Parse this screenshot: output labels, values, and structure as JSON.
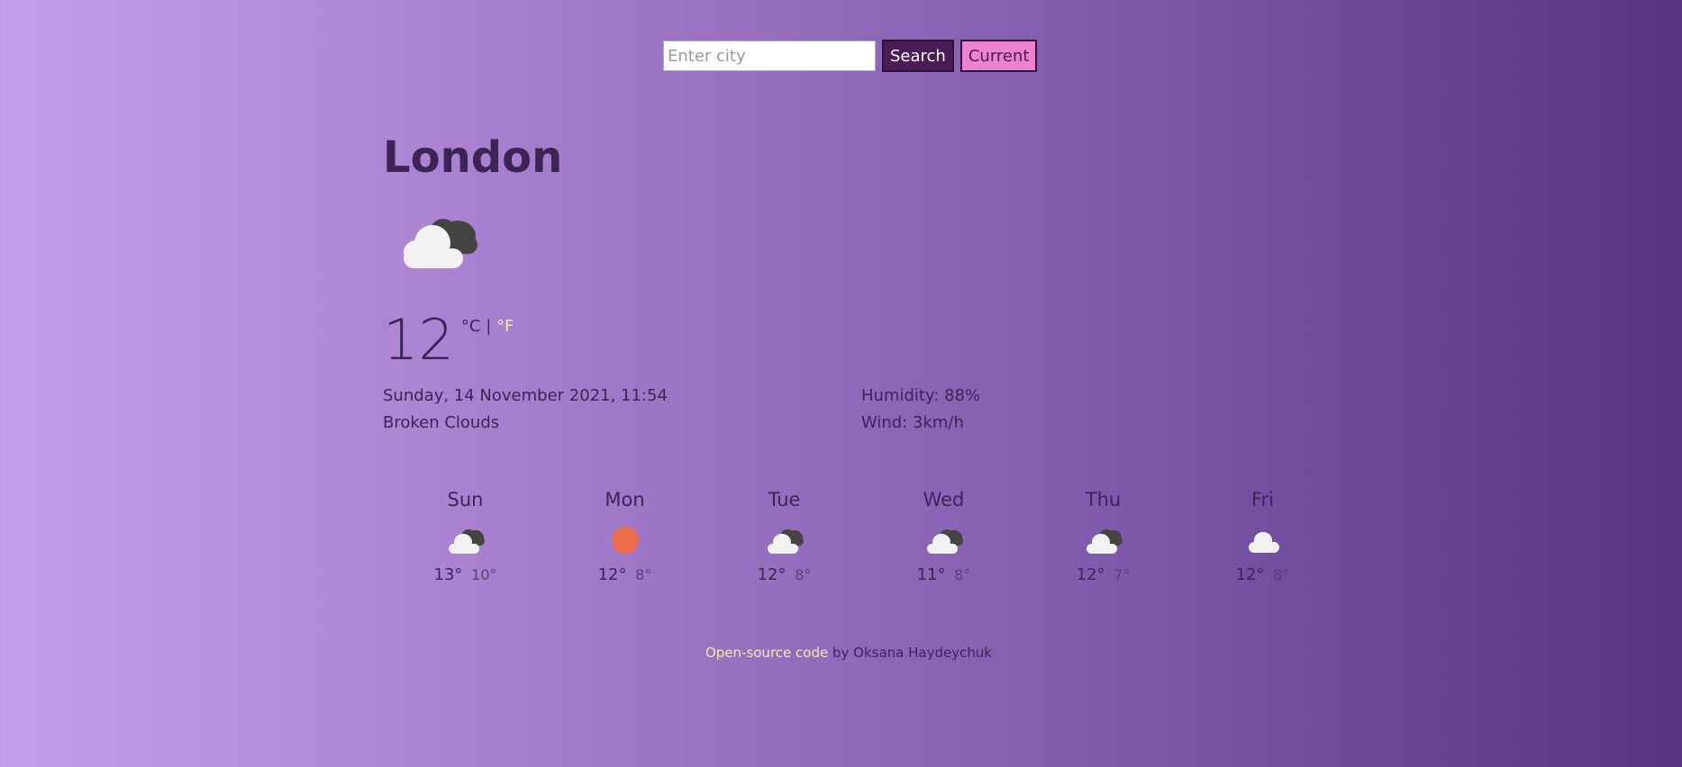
{
  "search": {
    "placeholder": "Enter city",
    "value": "",
    "search_label": "Search",
    "current_label": "Current"
  },
  "current": {
    "city": "London",
    "icon": "broken-clouds-icon",
    "temperature": "12",
    "unit_c": "°C",
    "separator": "|",
    "unit_f": "°F",
    "datetime": "Sunday, 14 November 2021, 11:54",
    "description": "Broken Clouds",
    "humidity": "Humidity: 88%",
    "wind": "Wind: 3km/h"
  },
  "forecast": [
    {
      "day": "Sun",
      "icon": "broken-clouds-icon",
      "max": "13°",
      "min": "10°"
    },
    {
      "day": "Mon",
      "icon": "sun-icon",
      "max": "12°",
      "min": "8°"
    },
    {
      "day": "Tue",
      "icon": "broken-clouds-icon",
      "max": "12°",
      "min": "8°"
    },
    {
      "day": "Wed",
      "icon": "broken-clouds-icon",
      "max": "11°",
      "min": "8°"
    },
    {
      "day": "Thu",
      "icon": "broken-clouds-icon",
      "max": "12°",
      "min": "7°"
    },
    {
      "day": "Fri",
      "icon": "cloud-icon",
      "max": "12°",
      "min": "8°"
    }
  ],
  "footer": {
    "link_text": "Open-source code",
    "author_text": " by Oksana Haydeychuk"
  },
  "colors": {
    "accent_yellow": "#f6e7a6",
    "search_button": "#4a1c55",
    "current_button": "#ee82d2",
    "sun": "#ec6e4c",
    "text": "#3c2456"
  }
}
